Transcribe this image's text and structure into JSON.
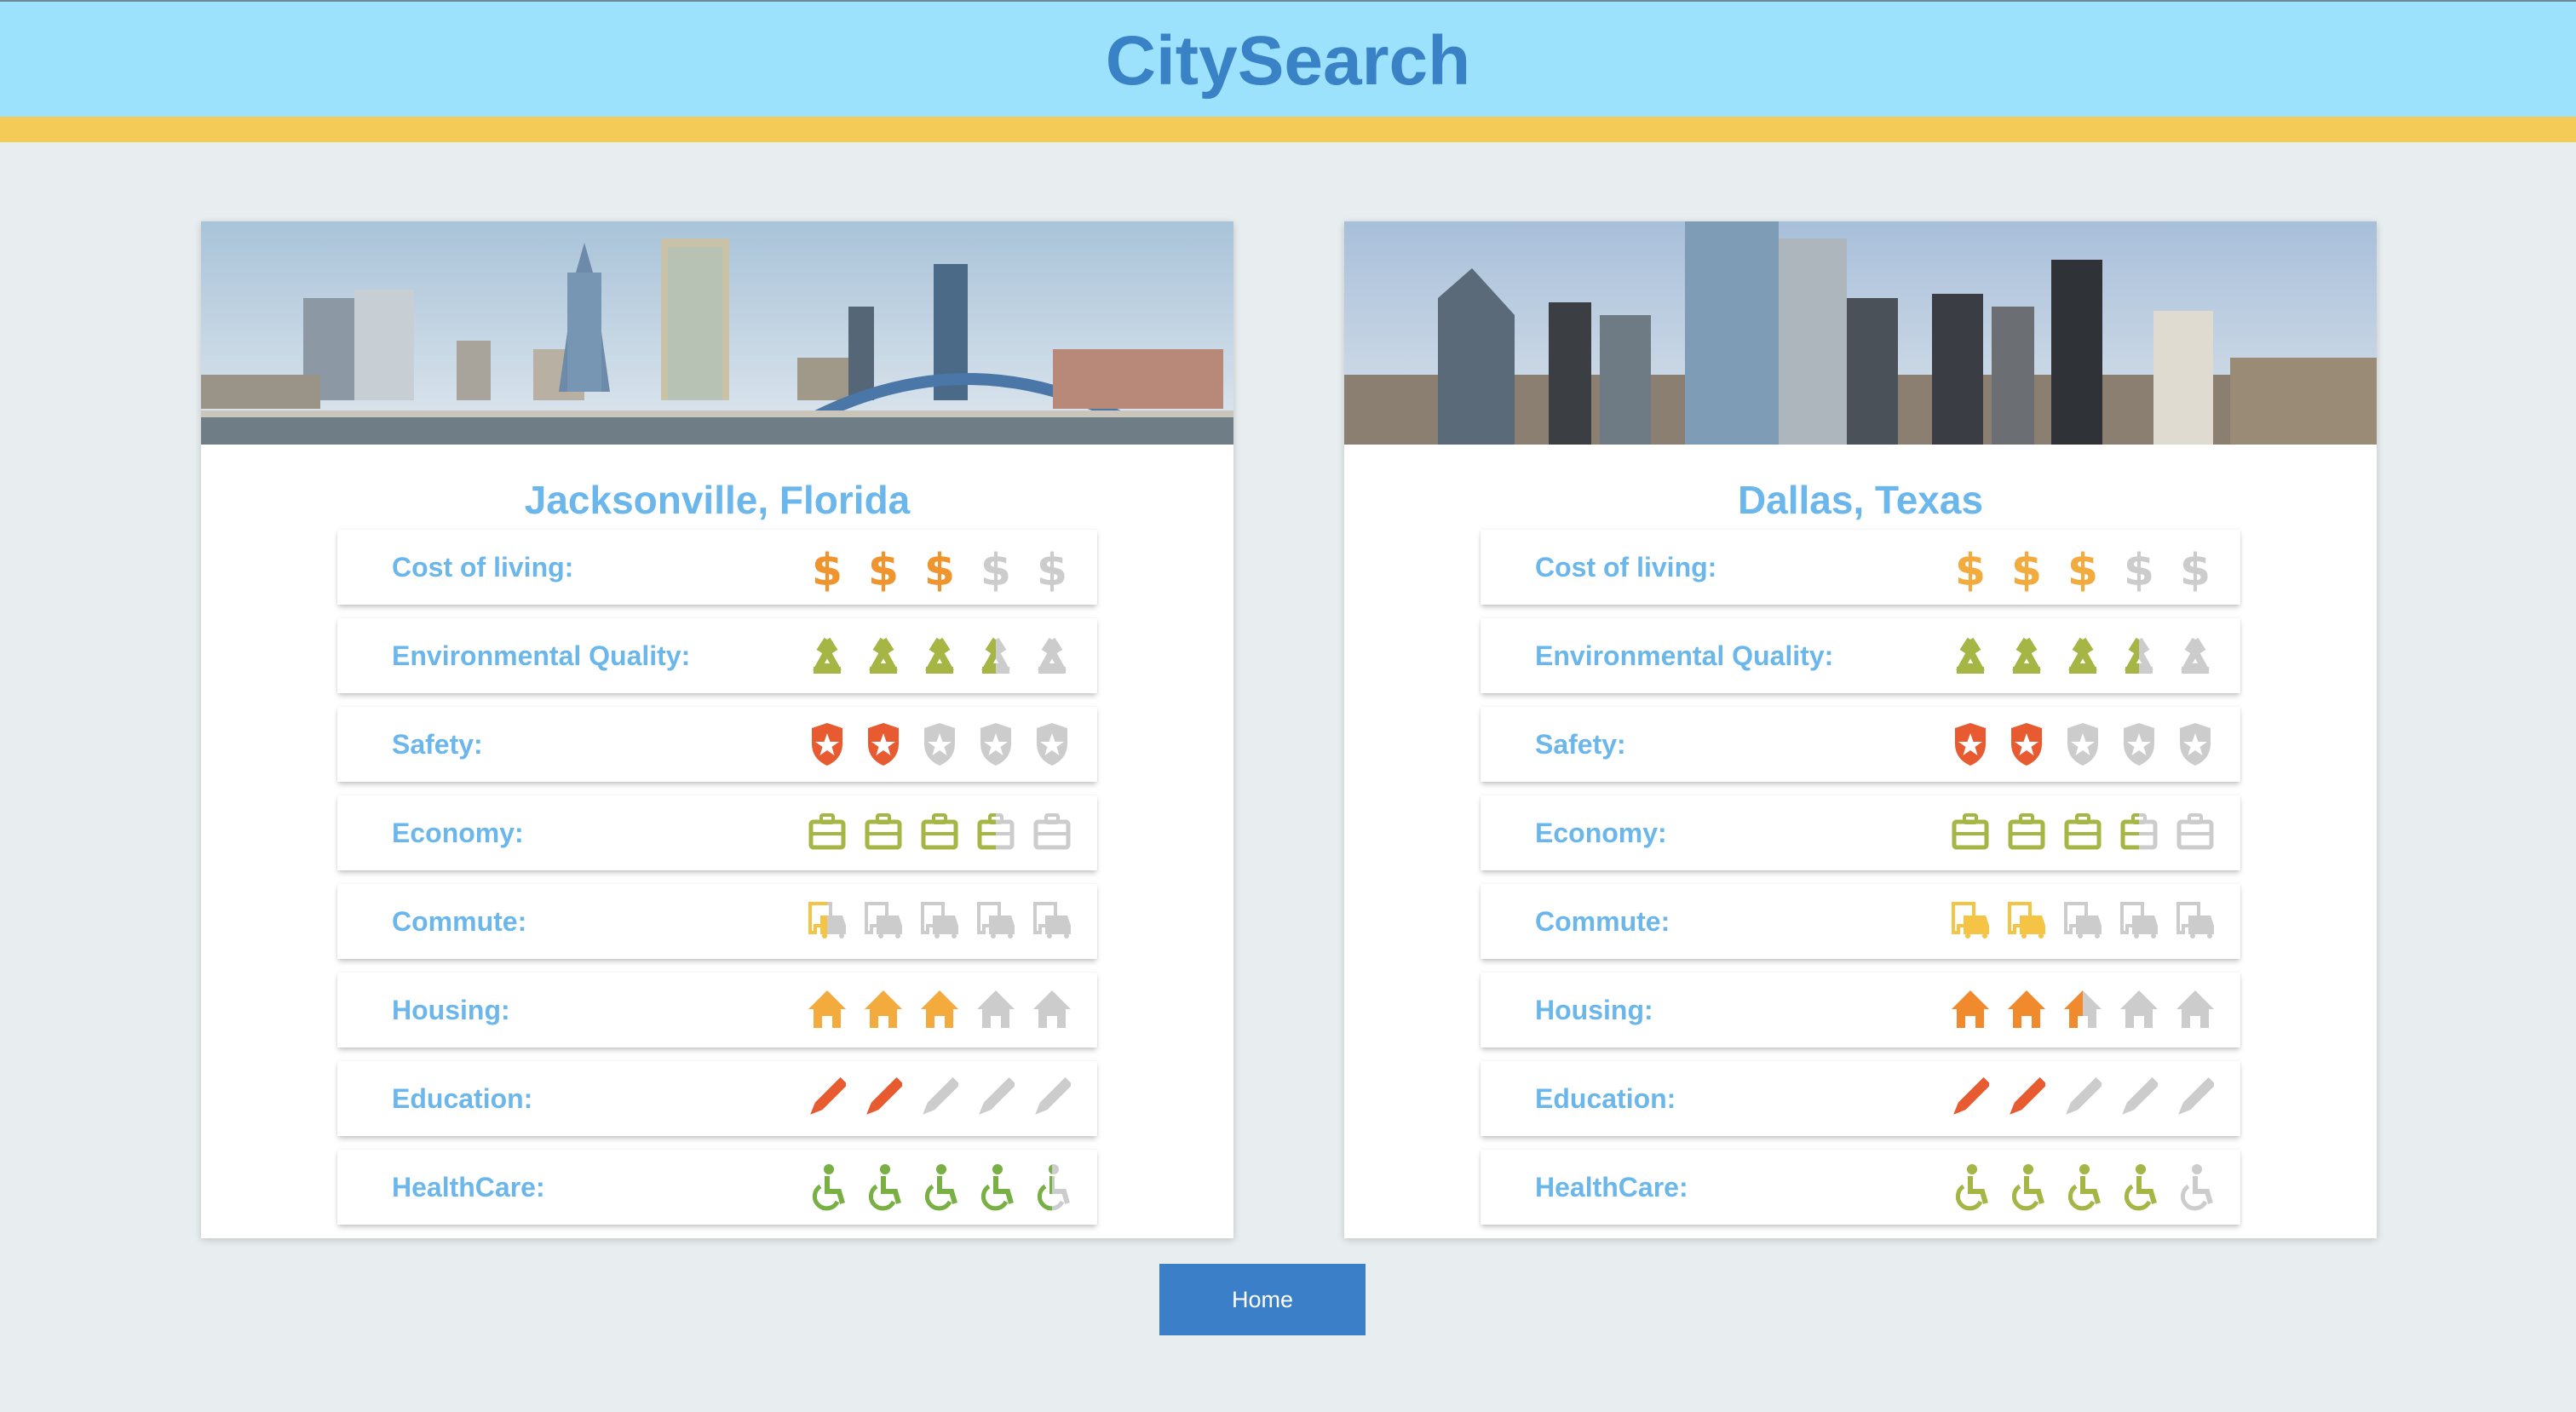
{
  "app": {
    "title": "CitySearch"
  },
  "colors": {
    "header_bg": "#9ce2fc",
    "stripe": "#f5cb57",
    "label": "#6bb6ea",
    "title": "#3a82c6",
    "inactive": "#cccccc",
    "button": "#3a7fc8"
  },
  "metrics": [
    {
      "key": "cost",
      "label": "Cost of living:",
      "icon": "dollar-icon"
    },
    {
      "key": "env",
      "label": "Environmental Quality:",
      "icon": "recycle-icon"
    },
    {
      "key": "safety",
      "label": "Safety:",
      "icon": "shield-star-icon"
    },
    {
      "key": "economy",
      "label": "Economy:",
      "icon": "briefcase-icon"
    },
    {
      "key": "commute",
      "label": "Commute:",
      "icon": "commute-icon"
    },
    {
      "key": "housing",
      "label": "Housing:",
      "icon": "house-icon"
    },
    {
      "key": "education",
      "label": "Education:",
      "icon": "pencil-icon"
    },
    {
      "key": "health",
      "label": "HealthCare:",
      "icon": "wheelchair-icon"
    }
  ],
  "cities": [
    {
      "name": "Jacksonville, Florida",
      "banner": "jacksonville-skyline-image",
      "ratings": {
        "cost": 3,
        "env": 3.5,
        "safety": 2,
        "economy": 3.5,
        "commute": 0.5,
        "housing": 3,
        "education": 2,
        "health": 4.5
      },
      "colors": {
        "cost": "#f0952e",
        "env": "#a6b644",
        "safety": "#e85a30",
        "economy": "#a6b644",
        "commute": "#f5c445",
        "housing": "#f4ab3e",
        "education": "#e85a30",
        "health": "#78b044"
      }
    },
    {
      "name": "Dallas, Texas",
      "banner": "dallas-skyline-image",
      "ratings": {
        "cost": 3,
        "env": 3.5,
        "safety": 2,
        "economy": 3.5,
        "commute": 2,
        "housing": 2.5,
        "education": 2,
        "health": 4
      },
      "colors": {
        "cost": "#f4ab3e",
        "env": "#a6b644",
        "safety": "#e85a30",
        "economy": "#a6b644",
        "commute": "#f5c445",
        "housing": "#f08a2c",
        "education": "#e85a30",
        "health": "#a6b644"
      }
    }
  ],
  "nav": {
    "home_label": "Home"
  }
}
